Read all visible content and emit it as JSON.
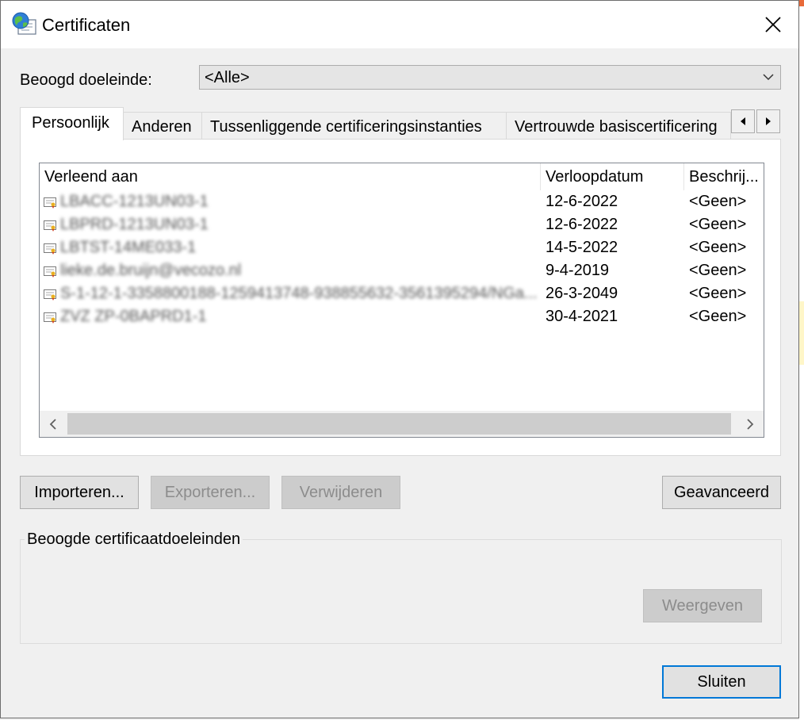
{
  "window": {
    "title": "Certificaten",
    "close_glyph": "✕"
  },
  "purpose": {
    "label": "Beoogd doeleinde:",
    "selected": "<Alle>"
  },
  "tabs": [
    {
      "label": "Persoonlijk",
      "active": true
    },
    {
      "label": "Anderen"
    },
    {
      "label": "Tussenliggende certificeringsinstanties"
    },
    {
      "label": "Vertrouwde basiscertificering"
    }
  ],
  "list": {
    "columns": [
      "Verleend aan",
      "Verloopdatum",
      "Beschrij..."
    ],
    "rows": [
      {
        "issued_to": "LBACC-1213UN03-1",
        "expires": "12-6-2022",
        "description": "<Geen>"
      },
      {
        "issued_to": "LBPRD-1213UN03-1",
        "expires": "12-6-2022",
        "description": "<Geen>"
      },
      {
        "issued_to": "LBTST-14ME033-1",
        "expires": "14-5-2022",
        "description": "<Geen>"
      },
      {
        "issued_to": "lieke.de.bruijn@vecozo.nl",
        "expires": "9-4-2019",
        "description": "<Geen>"
      },
      {
        "issued_to": "S-1-12-1-3358800188-1259413748-938855632-3561395294/NGa...",
        "expires": "26-3-2049",
        "description": "<Geen>"
      },
      {
        "issued_to": "ZVZ ZP-0BAPRD1-1",
        "expires": "30-4-2021",
        "description": "<Geen>"
      }
    ]
  },
  "buttons": {
    "import": "Importeren...",
    "export": "Exporteren...",
    "remove": "Verwijderen",
    "advanced": "Geavanceerd",
    "view": "Weergeven",
    "close": "Sluiten"
  },
  "purposes_group": {
    "label": "Beoogde certificaatdoeleinden"
  },
  "colors": {
    "accent": "#0078d7",
    "disabled_text": "#8c8c8c"
  }
}
